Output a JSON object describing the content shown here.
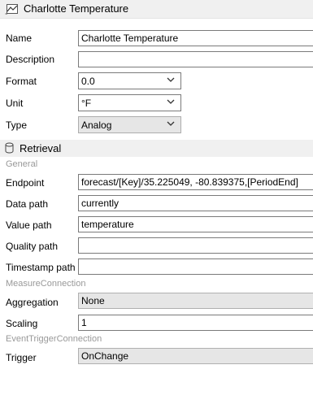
{
  "header": {
    "title": "Charlotte Temperature",
    "icon": "chart-line-icon"
  },
  "properties": {
    "name": {
      "label": "Name",
      "value": "Charlotte Temperature"
    },
    "description": {
      "label": "Description",
      "value": ""
    },
    "format": {
      "label": "Format",
      "value": "0.0"
    },
    "unit": {
      "label": "Unit",
      "value": "°F"
    },
    "type": {
      "label": "Type",
      "value": "Analog"
    }
  },
  "retrieval": {
    "title": "Retrieval",
    "icon": "database-icon",
    "general_label": "General",
    "endpoint": {
      "label": "Endpoint",
      "value": "forecast/[Key]/35.225049, -80.839375,[PeriodEnd]"
    },
    "data_path": {
      "label": "Data path",
      "value": "currently"
    },
    "value_path": {
      "label": "Value path",
      "value": "temperature"
    },
    "quality_path": {
      "label": "Quality path",
      "value": ""
    },
    "timestamp_path": {
      "label": "Timestamp path",
      "value": ""
    },
    "measure_connection_label": "MeasureConnection",
    "aggregation": {
      "label": "Aggregation",
      "value": "None"
    },
    "scaling": {
      "label": "Scaling",
      "value": "1"
    },
    "event_trigger_connection_label": "EventTriggerConnection",
    "trigger": {
      "label": "Trigger",
      "value": "OnChange"
    }
  },
  "colors": {
    "header_bg": "#f0f0f0",
    "readonly_bg": "#e6e6e6",
    "group_label": "#999999"
  }
}
